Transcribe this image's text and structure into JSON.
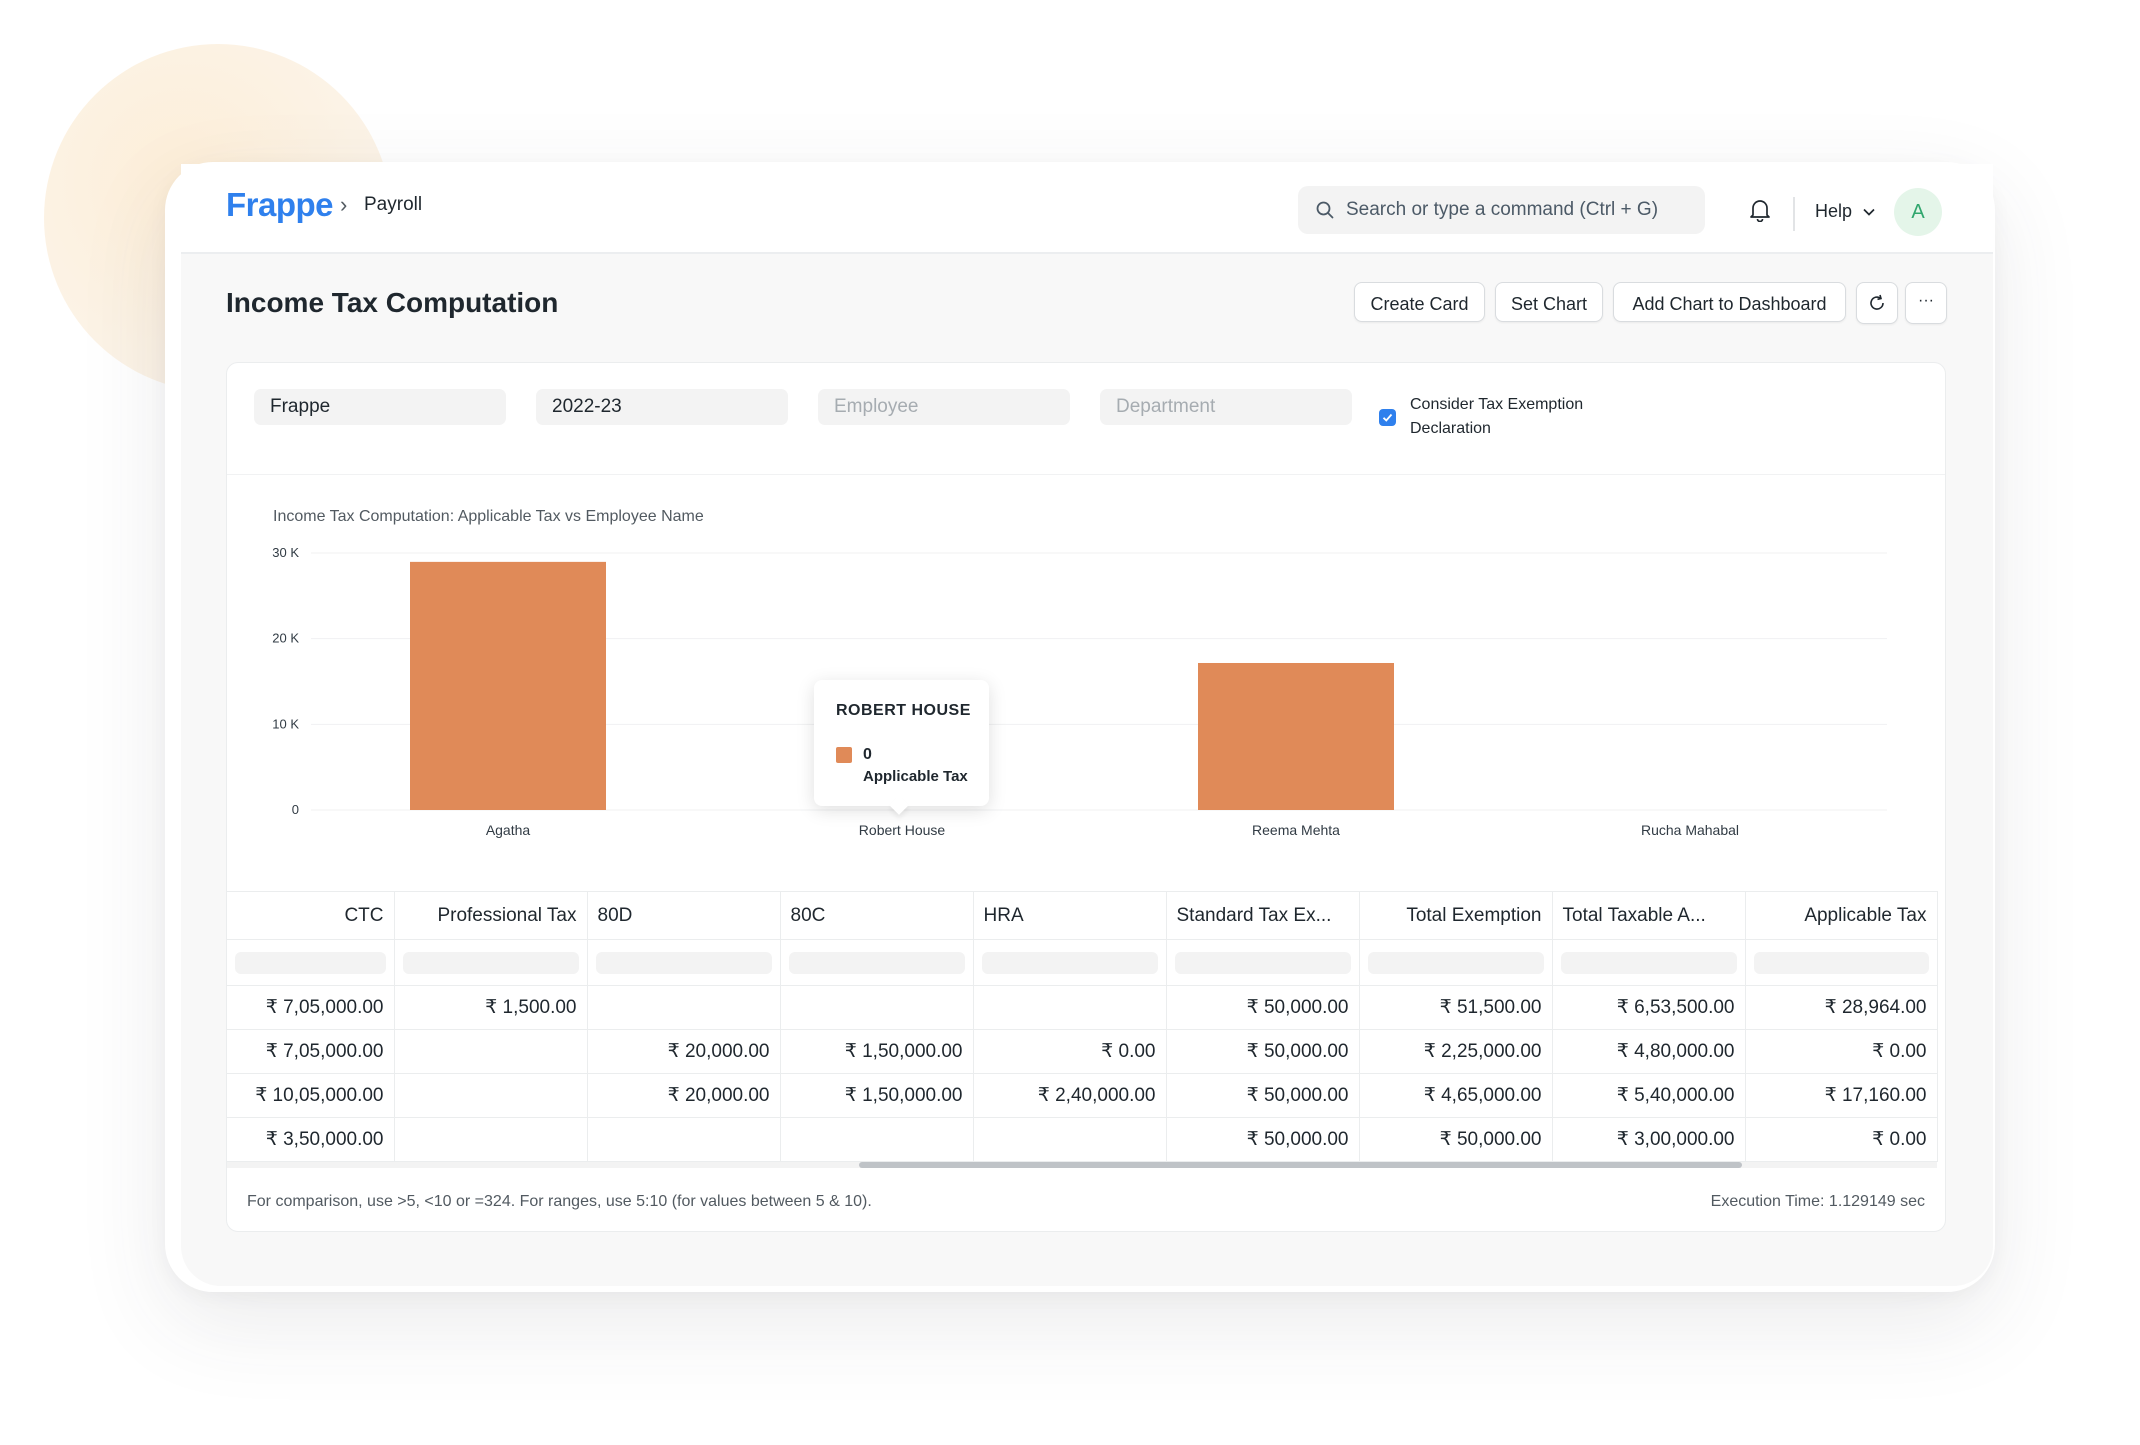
{
  "navbar": {
    "logo": "Frappe",
    "breadcrumb_sep": "›",
    "breadcrumb": "Payroll",
    "search_placeholder": "Search or type a command (Ctrl + G)",
    "help_label": "Help",
    "avatar_initial": "A"
  },
  "page": {
    "title": "Income Tax Computation",
    "actions": {
      "create_card": "Create Card",
      "set_chart": "Set Chart",
      "add_chart": "Add Chart to Dashboard",
      "more": "···"
    }
  },
  "filters": {
    "company": "Frappe",
    "payroll_period": "2022-23",
    "employee_placeholder": "Employee",
    "department_placeholder": "Department",
    "consider_exemption_label": "Consider Tax Exemption Declaration",
    "consider_exemption_checked": true
  },
  "chart_title": "Income Tax Computation: Applicable Tax vs Employee Name",
  "chart_data": {
    "type": "bar",
    "title": "Income Tax Computation: Applicable Tax vs Employee Name",
    "categories": [
      "Agatha",
      "Robert House",
      "Reema Mehta",
      "Rucha Mahabal"
    ],
    "series": [
      {
        "name": "Applicable Tax",
        "values": [
          28964,
          0,
          17160,
          0
        ]
      }
    ],
    "ylim": [
      0,
      30000
    ],
    "yticks": [
      0,
      10000,
      20000,
      30000
    ],
    "ytick_labels": [
      "0",
      "10 K",
      "20 K",
      "30 K"
    ],
    "bar_color": "#e08a58",
    "grid": true
  },
  "tooltip": {
    "title": "ROBERT HOUSE",
    "value": "0",
    "label": "Applicable Tax"
  },
  "table": {
    "columns": [
      "CTC",
      "Professional Tax",
      "80D",
      "80C",
      "HRA",
      "Standard Tax Ex...",
      "Total Exemption",
      "Total Taxable A...",
      "Applicable Tax"
    ],
    "rows": [
      [
        "₹ 7,05,000.00",
        "₹ 1,500.00",
        "",
        "",
        "",
        "₹ 50,000.00",
        "₹ 51,500.00",
        "₹ 6,53,500.00",
        "₹ 28,964.00"
      ],
      [
        "₹ 7,05,000.00",
        "",
        "₹ 20,000.00",
        "₹ 1,50,000.00",
        "₹ 0.00",
        "₹ 50,000.00",
        "₹ 2,25,000.00",
        "₹ 4,80,000.00",
        "₹ 0.00"
      ],
      [
        "₹ 10,05,000.00",
        "",
        "₹ 20,000.00",
        "₹ 1,50,000.00",
        "₹ 2,40,000.00",
        "₹ 50,000.00",
        "₹ 4,65,000.00",
        "₹ 5,40,000.00",
        "₹ 17,160.00"
      ],
      [
        "₹ 3,50,000.00",
        "",
        "",
        "",
        "",
        "₹ 50,000.00",
        "₹ 50,000.00",
        "₹ 3,00,000.00",
        "₹ 0.00"
      ]
    ]
  },
  "footer": {
    "note": "For comparison, use >5, <10 or =324. For ranges, use 5:10 (for values between 5 & 10).",
    "execution_time": "Execution Time: 1.129149 sec"
  }
}
